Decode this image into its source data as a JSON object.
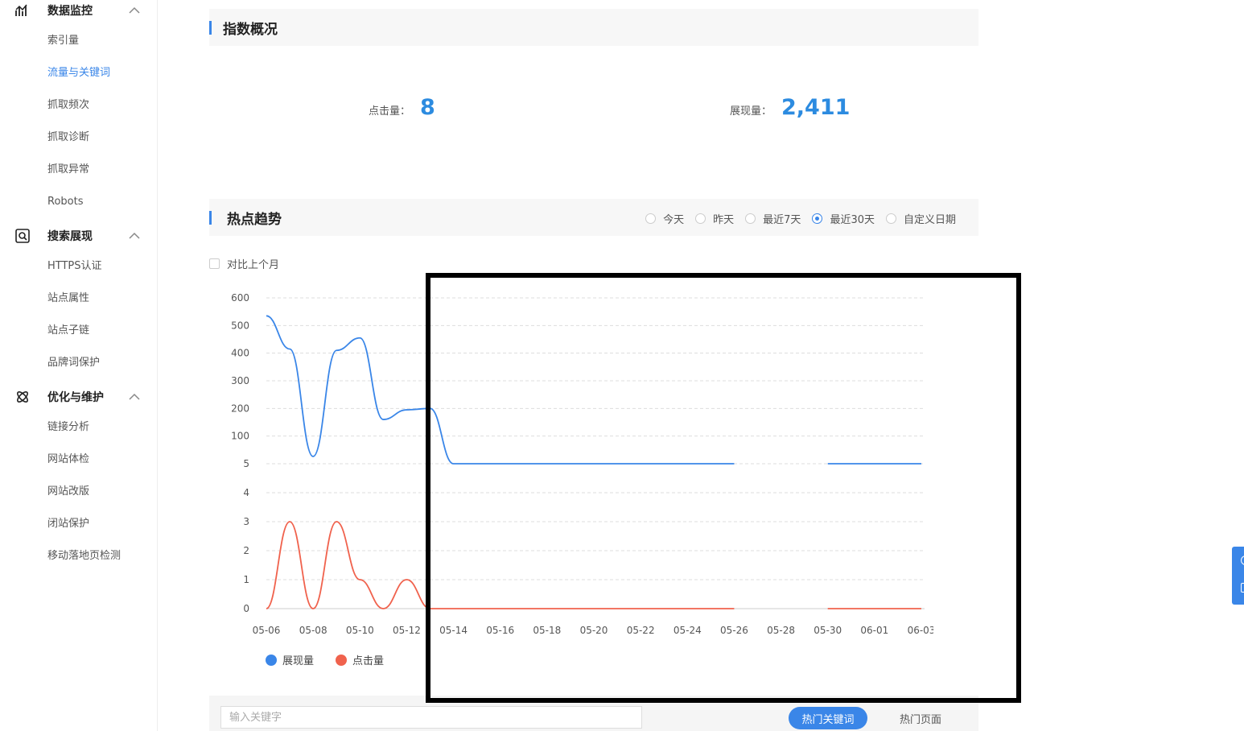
{
  "sidebar": {
    "groups": [
      {
        "title": "数据监控",
        "icon": "bar-chart-icon",
        "items": [
          "索引量",
          "流量与关键词",
          "抓取频次",
          "抓取诊断",
          "抓取异常",
          "Robots"
        ]
      },
      {
        "title": "搜索展现",
        "icon": "search-doc-icon",
        "items": [
          "HTTPS认证",
          "站点属性",
          "站点子链",
          "品牌词保护"
        ]
      },
      {
        "title": "优化与维护",
        "icon": "tools-icon",
        "items": [
          "链接分析",
          "网站体检",
          "网站改版",
          "闭站保护",
          "移动落地页检测"
        ]
      }
    ],
    "active_item": "流量与关键词"
  },
  "overview": {
    "title": "指数概况",
    "clicks_label": "点击量：",
    "clicks_value": "8",
    "impressions_label": "展现量：",
    "impressions_value": "2,411"
  },
  "trend": {
    "title": "热点趋势",
    "ranges": [
      {
        "label": "今天",
        "selected": false
      },
      {
        "label": "昨天",
        "selected": false
      },
      {
        "label": "最近7天",
        "selected": false
      },
      {
        "label": "最近30天",
        "selected": true
      },
      {
        "label": "自定义日期",
        "selected": false
      }
    ],
    "compare_label": "对比上个月",
    "compare_checked": false
  },
  "chart_data": {
    "type": "line",
    "x": [
      "05-06",
      "05-07",
      "05-08",
      "05-09",
      "05-10",
      "05-11",
      "05-12",
      "05-13",
      "05-14",
      "05-15",
      "05-16",
      "05-17",
      "05-18",
      "05-19",
      "05-20",
      "05-21",
      "05-22",
      "05-23",
      "05-24",
      "05-25",
      "05-26",
      "05-27",
      "05-28",
      "05-29",
      "05-30",
      "05-31",
      "06-01",
      "06-02",
      "06-03"
    ],
    "x_tick_labels": [
      "05-06",
      "05-08",
      "05-10",
      "05-12",
      "05-14",
      "05-16",
      "05-18",
      "05-20",
      "05-22",
      "05-24",
      "05-26",
      "05-28",
      "05-30",
      "06-01",
      "06-03"
    ],
    "top_panel": {
      "y_ticks": [
        "600",
        "500",
        "400",
        "300",
        "200",
        "100",
        "5"
      ],
      "ylim": [
        5,
        600
      ],
      "series": [
        {
          "name": "展现量",
          "color": "#3a86e8",
          "values": [
            535,
            415,
            30,
            410,
            455,
            160,
            195,
            200,
            5,
            5,
            5,
            5,
            5,
            5,
            5,
            5,
            5,
            5,
            5,
            5,
            5,
            null,
            null,
            null,
            5,
            5,
            5,
            5,
            5
          ]
        }
      ]
    },
    "bottom_panel": {
      "y_ticks": [
        "4",
        "3",
        "2",
        "1",
        "0"
      ],
      "ylim": [
        0,
        5
      ],
      "series": [
        {
          "name": "点击量",
          "color": "#f0624d",
          "values": [
            0,
            3,
            0,
            3,
            1,
            0,
            1,
            0,
            0,
            0,
            0,
            0,
            0,
            0,
            0,
            0,
            0,
            0,
            0,
            0,
            0,
            null,
            null,
            null,
            0,
            0,
            0,
            0,
            0
          ]
        }
      ]
    },
    "legend": [
      {
        "name": "展现量",
        "color": "#3a86e8"
      },
      {
        "name": "点击量",
        "color": "#f0624d"
      }
    ],
    "grid": true,
    "legend_position": "bottom-left"
  },
  "table_controls": {
    "search_placeholder": "输入关键字",
    "hot_keywords_label": "热门关键词",
    "hot_pages_label": "热门页面"
  }
}
